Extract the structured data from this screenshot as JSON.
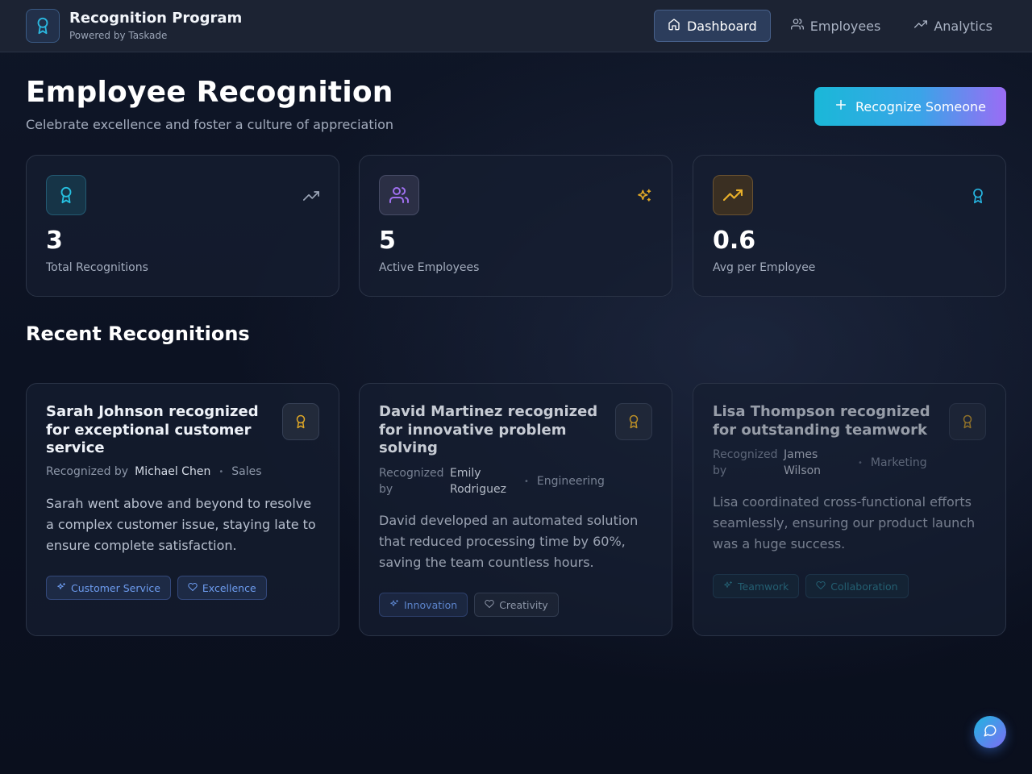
{
  "brand": {
    "title": "Recognition Program",
    "subtitle": "Powered by Taskade",
    "logo_icon": "award-icon"
  },
  "nav": [
    {
      "label": "Dashboard",
      "icon": "home-icon",
      "active": true
    },
    {
      "label": "Employees",
      "icon": "users-icon",
      "active": false
    },
    {
      "label": "Analytics",
      "icon": "trending-up-icon",
      "active": false
    }
  ],
  "page": {
    "title": "Employee Recognition",
    "subtitle": "Celebrate excellence and foster a culture of appreciation",
    "cta_label": "Recognize Someone"
  },
  "stats": [
    {
      "value": "3",
      "label": "Total Recognitions",
      "icon": "award-icon",
      "corner_icon": "trending-up-icon"
    },
    {
      "value": "5",
      "label": "Active Employees",
      "icon": "users-icon",
      "corner_icon": "sparkles-icon"
    },
    {
      "value": "0.6",
      "label": "Avg per Employee",
      "icon": "trending-up-icon",
      "corner_icon": "award-icon"
    }
  ],
  "recent": {
    "title": "Recent Recognitions",
    "by_label": "Recognized by",
    "items": [
      {
        "title": "Sarah Johnson recognized for exceptional customer service",
        "by_name": "Michael Chen",
        "department": "Sales",
        "message": "Sarah went above and beyond to resolve a complex customer issue, staying late to ensure complete satisfaction.",
        "tags": [
          {
            "label": "Customer Service",
            "icon": "sparkles-icon"
          },
          {
            "label": "Excellence",
            "icon": "heart-icon"
          }
        ]
      },
      {
        "title": "David Martinez recognized for innovative problem solving",
        "by_name": "Emily Rodriguez",
        "department": "Engineering",
        "message": "David developed an automated solution that reduced processing time by 60%, saving the team countless hours.",
        "tags": [
          {
            "label": "Innovation",
            "icon": "sparkles-icon"
          },
          {
            "label": "Creativity",
            "icon": "heart-icon"
          }
        ]
      },
      {
        "title": "Lisa Thompson recognized for outstanding teamwork",
        "by_name": "James Wilson",
        "department": "Marketing",
        "message": "Lisa coordinated cross-functional efforts seamlessly, ensuring our product launch was a huge success.",
        "tags": [
          {
            "label": "Teamwork",
            "icon": "sparkles-icon"
          },
          {
            "label": "Collaboration",
            "icon": "heart-icon"
          }
        ]
      }
    ]
  },
  "colors": {
    "accent_cyan": "#22b8d8",
    "accent_purple": "#9b6cf5",
    "gold": "#e0a826",
    "tag_blue": "#6d9cf0"
  },
  "chat_icon": "message-circle-icon"
}
